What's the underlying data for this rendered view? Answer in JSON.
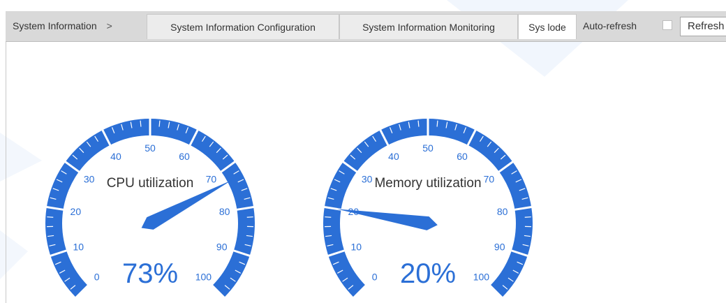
{
  "breadcrumb": {
    "label": "System Information",
    "separator": ">"
  },
  "tabs": [
    {
      "label": "System Information Configuration",
      "active": false
    },
    {
      "label": "System Information Monitoring",
      "active": false
    },
    {
      "label": "Sys lode",
      "active": true
    }
  ],
  "auto_refresh": {
    "label": "Auto-refresh",
    "checked": false
  },
  "refresh_button": {
    "label": "Refresh"
  },
  "gauges": [
    {
      "title": "CPU utilization",
      "value": 73,
      "display": "73%",
      "min": 0,
      "max": 100
    },
    {
      "title": "Memory utilization",
      "value": 20,
      "display": "20%",
      "min": 0,
      "max": 100
    }
  ],
  "colors": {
    "gauge_blue": "#2b6fd6",
    "toolbar_bg": "#d9d9d9",
    "watermark": "#eaf1fb"
  }
}
